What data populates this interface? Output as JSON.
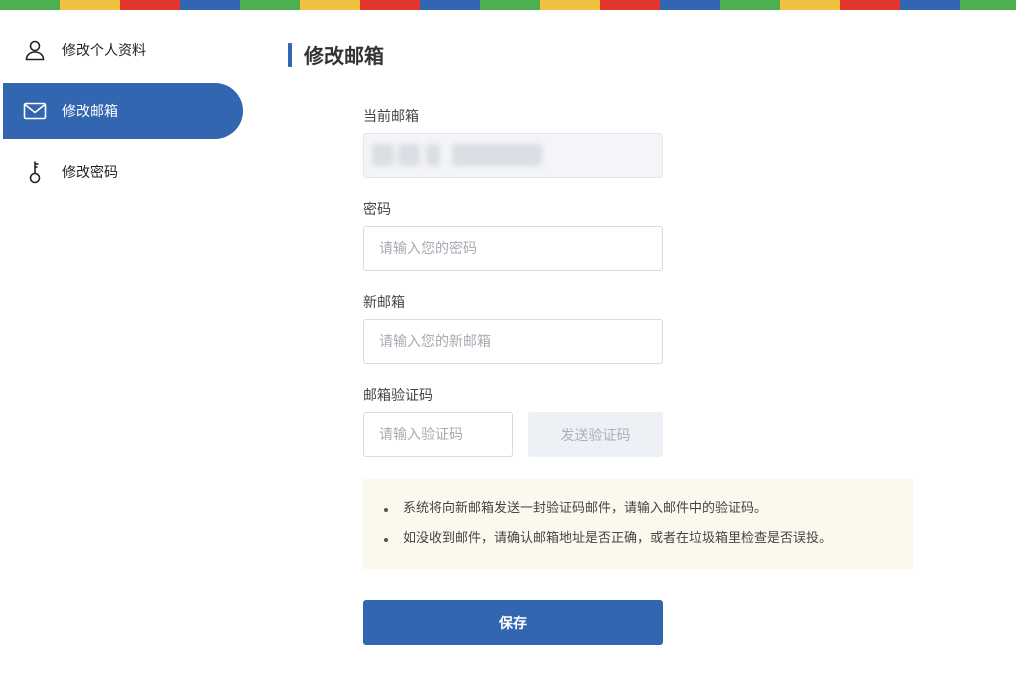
{
  "colors": {
    "accent": "#3366b0",
    "stripe": [
      "#4caf50",
      "#f0c040",
      "#e0362c",
      "#3366b0"
    ]
  },
  "sidebar": {
    "items": [
      {
        "label": "修改个人资料",
        "icon": "user-icon",
        "active": false
      },
      {
        "label": "修改邮箱",
        "icon": "mail-icon",
        "active": true
      },
      {
        "label": "修改密码",
        "icon": "key-icon",
        "active": false
      }
    ]
  },
  "page": {
    "title": "修改邮箱"
  },
  "form": {
    "current_email_label": "当前邮箱",
    "password_label": "密码",
    "password_placeholder": "请输入您的密码",
    "new_email_label": "新邮箱",
    "new_email_placeholder": "请输入您的新邮箱",
    "code_label": "邮箱验证码",
    "code_placeholder": "请输入验证码",
    "send_code_label": "发送验证码",
    "save_label": "保存"
  },
  "notice": {
    "items": [
      "系统将向新邮箱发送一封验证码邮件，请输入邮件中的验证码。",
      "如没收到邮件，请确认邮箱地址是否正确，或者在垃圾箱里检查是否误投。"
    ]
  }
}
